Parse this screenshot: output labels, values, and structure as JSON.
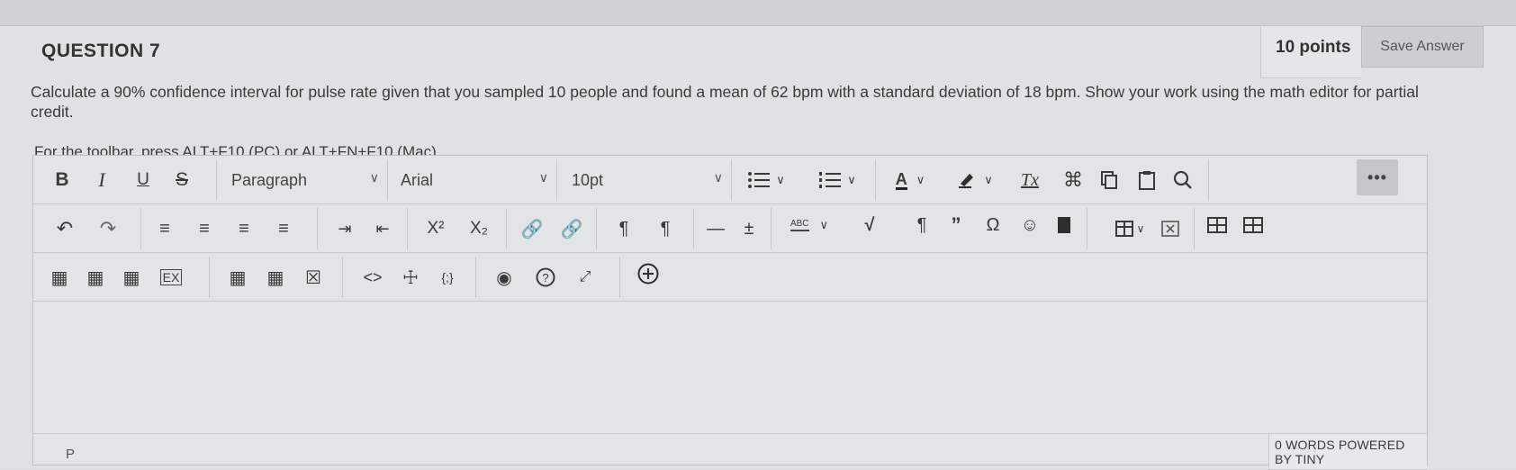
{
  "question": {
    "title": "QUESTION 7",
    "points": "10 points",
    "save_label": "Save Answer",
    "text": "Calculate a 90% confidence interval for pulse rate given that you sampled 10 people and found a mean of 62 bpm with a standard deviation of 18 bpm. Show your work using the math editor for partial credit."
  },
  "editor": {
    "hint": "For the toolbar, press ALT+F10 (PC) or ALT+FN+F10 (Mac).",
    "block_format": "Paragraph",
    "font_family": "Arial",
    "font_size": "10pt",
    "bold_label": "B",
    "italic_label": "I",
    "underline_label": "U",
    "strike_label": "S",
    "superscript_label": "X²",
    "subscript_label": "X₂",
    "text_color_label": "A",
    "clear_format_label": "Tx",
    "spellcheck_label": "ABC",
    "more_label": "•••",
    "path": "P",
    "word_count": "0 WORDS POWERED BY TINY"
  },
  "icons": [
    "bold-icon",
    "italic-icon",
    "underline-icon",
    "strikethrough-icon",
    "bullet-list-icon",
    "numbered-list-icon",
    "text-color-icon",
    "highlight-icon",
    "clear-format-icon",
    "cut-icon",
    "copy-icon",
    "paste-icon",
    "search-icon",
    "undo-icon",
    "redo-icon",
    "align-left-icon",
    "align-center-icon",
    "align-right-icon",
    "justify-icon",
    "indent-icon",
    "outdent-icon",
    "link-icon",
    "unlink-icon",
    "ltr-icon",
    "rtl-icon",
    "horizontal-rule-icon",
    "insert-line-icon",
    "spellcheck-icon",
    "math-icon",
    "paragraph-mark-icon",
    "quote-icon",
    "special-char-icon",
    "emoji-icon",
    "bookmark-icon",
    "table-icon",
    "delete-table-icon",
    "preview-icon",
    "help-icon",
    "fullscreen-icon",
    "add-content-icon",
    "code-icon",
    "accessibility-icon",
    "mashup-icon"
  ]
}
